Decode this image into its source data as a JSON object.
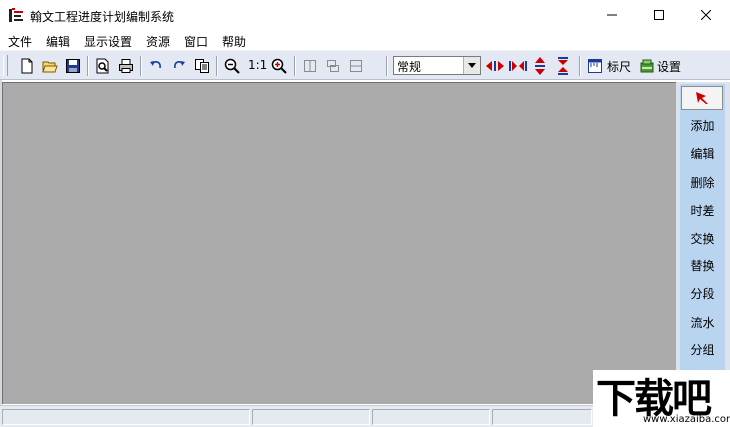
{
  "window": {
    "title": "翰文工程进度计划编制系统",
    "icon": "app-logo-icon",
    "controls": [
      "minimize-icon",
      "maximize-icon",
      "close-icon"
    ]
  },
  "menu": [
    {
      "label": "文件"
    },
    {
      "label": "编辑"
    },
    {
      "label": "显示设置"
    },
    {
      "label": "资源"
    },
    {
      "label": "窗口"
    },
    {
      "label": "帮助"
    }
  ],
  "toolbar": {
    "zoom_1to1_label": "1:1",
    "view_select_value": "常规",
    "ruler_label": "标尺",
    "settings_label": "设置",
    "icons": [
      "new-file-icon",
      "open-folder-icon",
      "save-icon",
      "print-preview-icon",
      "print-icon",
      "undo-icon",
      "redo-icon",
      "copy-icon",
      "zoom-out-icon",
      "zoom-in-icon",
      "layout-split-icon",
      "layout-cascade-icon",
      "layout-stack-icon",
      "expand-horizontal-icon",
      "collapse-horizontal-icon",
      "expand-vertical-icon",
      "collapse-vertical-icon",
      "ruler-icon",
      "settings-icon"
    ]
  },
  "side_panel": {
    "pointer": "pointer-arrow-icon",
    "buttons": [
      {
        "label": "添加"
      },
      {
        "label": "编辑"
      },
      {
        "label": "删除"
      },
      {
        "label": "时差"
      },
      {
        "label": "交换"
      },
      {
        "label": "替换"
      },
      {
        "label": "分段"
      },
      {
        "label": "流水"
      },
      {
        "label": "分组"
      }
    ]
  },
  "watermark": {
    "text": "下载吧",
    "subtext": "www.xiazaiba.com"
  },
  "colors": {
    "workspace": "#ababab",
    "toolbar": "#e3e8f2",
    "side_panel": "#b9d4ef",
    "pointer_arrow": "#cc0000"
  }
}
